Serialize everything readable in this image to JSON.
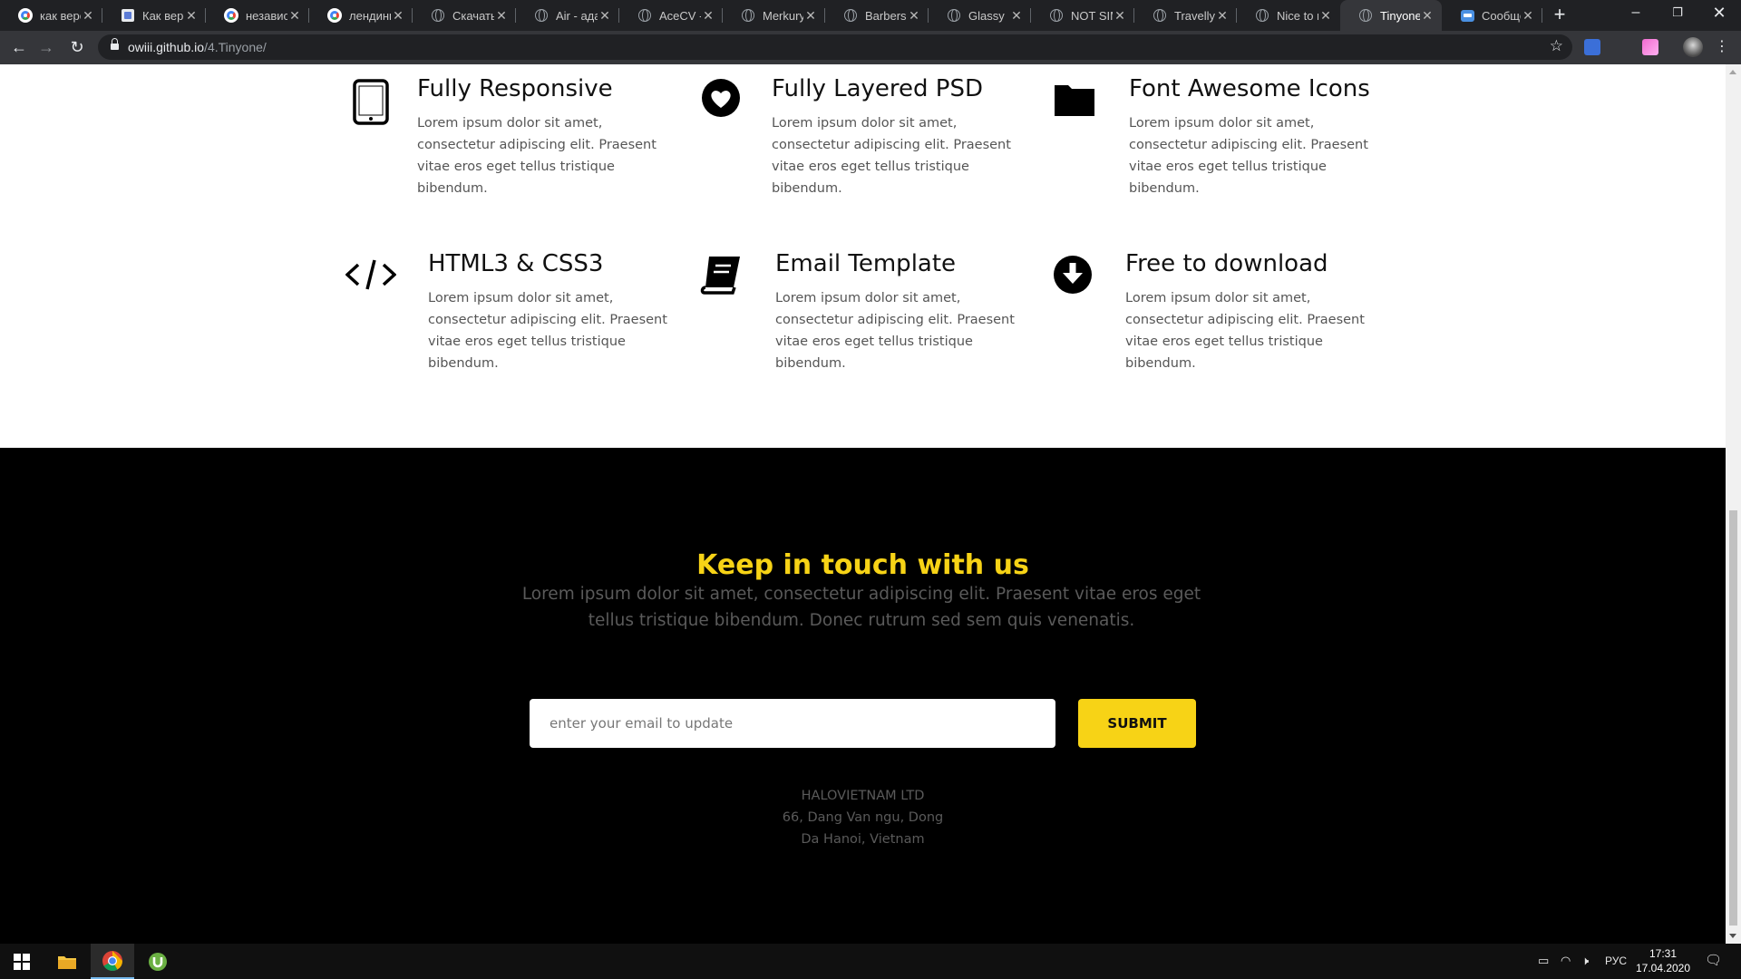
{
  "browser": {
    "tabs": [
      {
        "title": "как верс",
        "favicon": "google-icon"
      },
      {
        "title": "Как верс",
        "favicon": "doc-icon"
      },
      {
        "title": "независи",
        "favicon": "google-icon"
      },
      {
        "title": "лендинг",
        "favicon": "google-icon"
      },
      {
        "title": "Скачать",
        "favicon": "globe-icon"
      },
      {
        "title": "Air - адап",
        "favicon": "globe-icon"
      },
      {
        "title": "AceCV - F",
        "favicon": "globe-icon"
      },
      {
        "title": "Merkury",
        "favicon": "globe-icon"
      },
      {
        "title": "Barbersh",
        "favicon": "globe-icon"
      },
      {
        "title": "Glassy",
        "favicon": "globe-icon"
      },
      {
        "title": "NOT SIM",
        "favicon": "globe-icon"
      },
      {
        "title": "Travelly",
        "favicon": "globe-icon"
      },
      {
        "title": "Nice to m",
        "favicon": "globe-icon"
      },
      {
        "title": "Tinyone",
        "favicon": "globe-icon",
        "active": true
      },
      {
        "title": "Сообще",
        "favicon": "message-icon"
      }
    ],
    "url_host": "owiii.github.io",
    "url_path": "/4.Tinyone/"
  },
  "features": [
    {
      "title": "Fully Responsive",
      "text": "Lorem ipsum dolor sit amet, consectetur adipiscing elit. Praesent vitae eros eget tellus tristique bibendum.",
      "icon": "tablet-icon"
    },
    {
      "title": "Fully Layered PSD",
      "text": "Lorem ipsum dolor sit amet, consectetur adipiscing elit. Praesent vitae eros eget tellus tristique bibendum.",
      "icon": "heart-circle-icon"
    },
    {
      "title": "Font Awesome Icons",
      "text": "Lorem ipsum dolor sit amet, consectetur adipiscing elit. Praesent vitae eros eget tellus tristique bibendum.",
      "icon": "folder-icon"
    },
    {
      "title": "HTML3 & CSS3",
      "text": "Lorem ipsum dolor sit amet, consectetur adipiscing elit. Praesent vitae eros eget tellus tristique bibendum.",
      "icon": "code-icon"
    },
    {
      "title": "Email Template",
      "text": "Lorem ipsum dolor sit amet, consectetur adipiscing elit. Praesent vitae eros eget tellus tristique bibendum.",
      "icon": "book-icon"
    },
    {
      "title": "Free to download",
      "text": "Lorem ipsum dolor sit amet, consectetur adipiscing elit. Praesent vitae eros eget tellus tristique bibendum.",
      "icon": "download-circle-icon"
    }
  ],
  "footer": {
    "title": "Keep in touch with us",
    "text": "Lorem ipsum dolor sit amet, consectetur adipiscing elit. Praesent vitae eros eget tellus tristique bibendum. Donec rutrum sed sem quis venenatis.",
    "email_placeholder": "enter your email to update",
    "submit_label": "SUBMIT",
    "company": "HALOVIETNAM LTD",
    "address_line1": "66, Dang Van ngu, Dong",
    "address_line2": "Da Hanoi, Vietnam"
  },
  "taskbar": {
    "language": "РУС",
    "time": "17:31",
    "date": "17.04.2020"
  },
  "colors": {
    "accent": "#f7d316",
    "footer_bg": "#000000",
    "chrome_dark": "#202124",
    "chrome_toolbar": "#35363a"
  }
}
